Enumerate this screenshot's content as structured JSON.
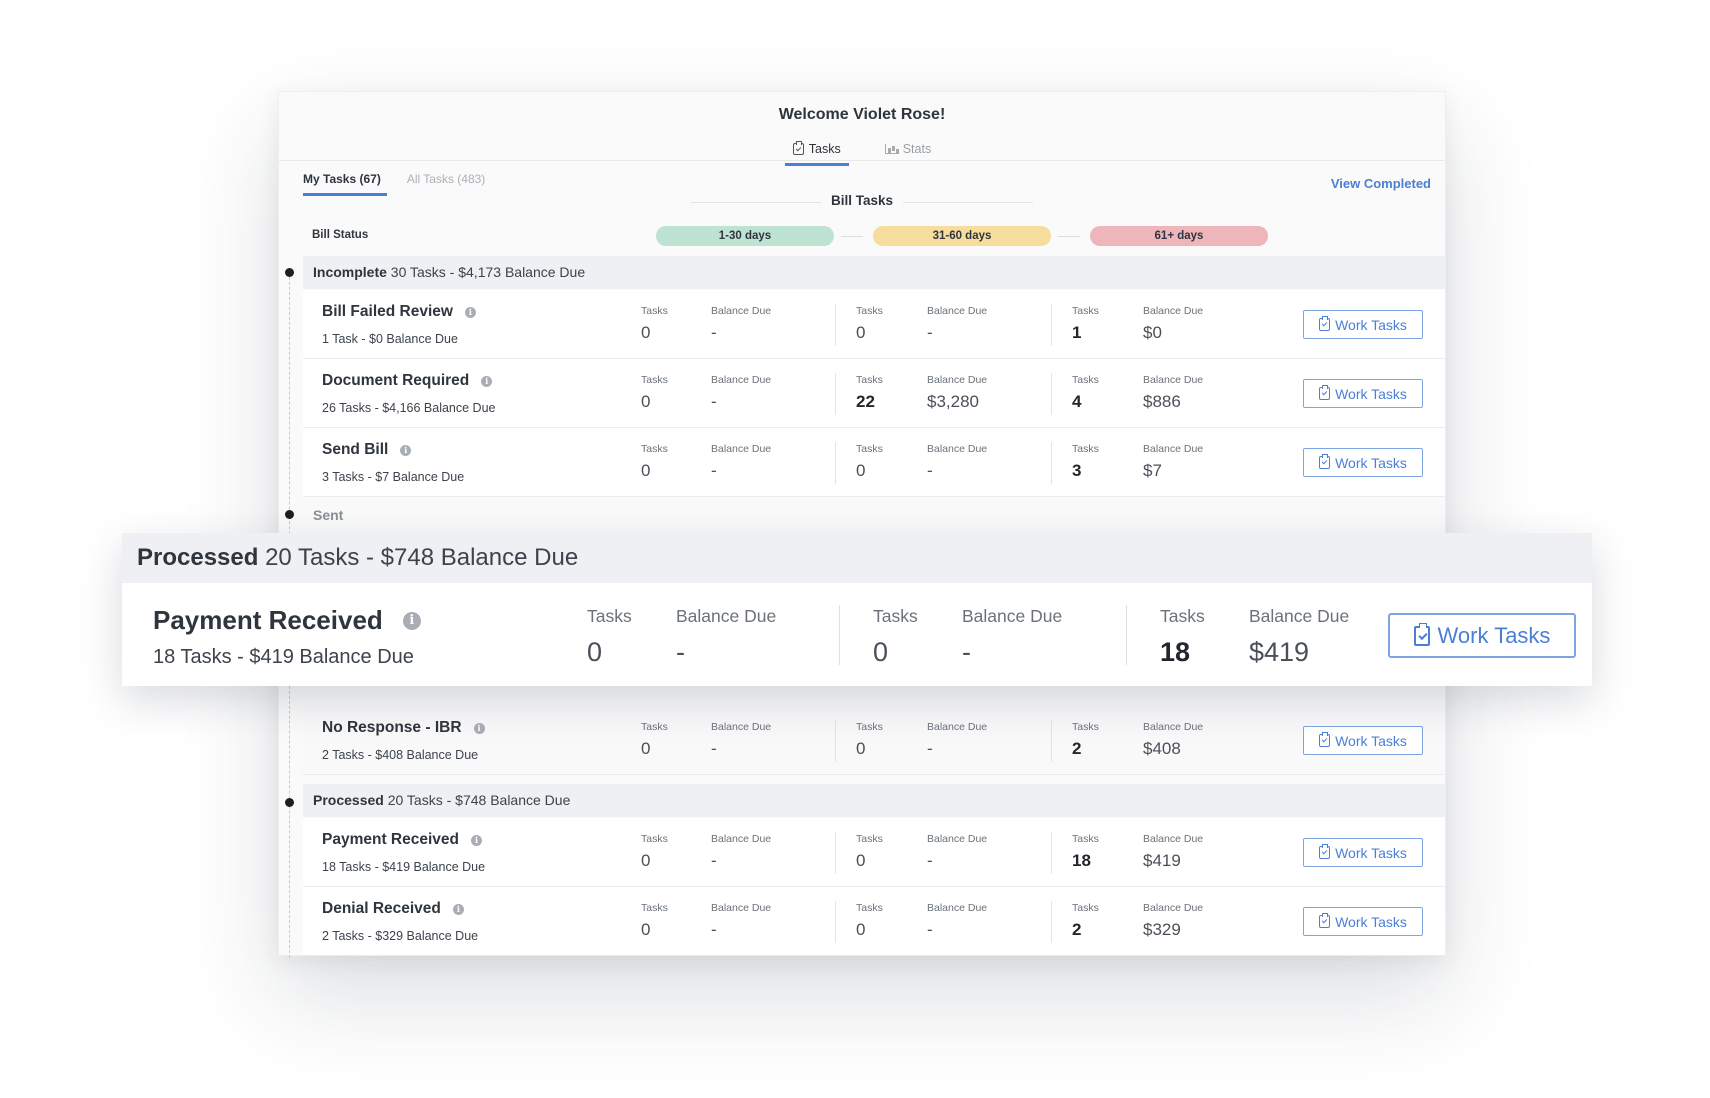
{
  "header": {
    "welcome": "Welcome Violet Rose!",
    "tabs": [
      {
        "label": "Tasks",
        "icon": "clipboard-check-icon",
        "active": true
      },
      {
        "label": "Stats",
        "icon": "bar-chart-icon",
        "active": false
      }
    ]
  },
  "subtabs": [
    {
      "label": "My Tasks (67)",
      "active": true
    },
    {
      "label": "All Tasks (483)",
      "active": false
    }
  ],
  "view_completed": "View Completed",
  "section_title": "Bill Tasks",
  "bill_status_label": "Bill Status",
  "ranges": [
    "1-30 days",
    "31-60 days",
    "61+ days"
  ],
  "range_colors": [
    "#bee3d2",
    "#f7dd9d",
    "#eeb5bb"
  ],
  "accent_color": "#4a7fd6",
  "labels": {
    "tasks": "Tasks",
    "balance": "Balance Due",
    "work_tasks": "Work Tasks"
  },
  "groups": {
    "incomplete": {
      "name": "Incomplete",
      "summary": " 30 Tasks - $4,173 Balance Due"
    },
    "sent": {
      "name": "Sent"
    },
    "processed": {
      "name": "Processed",
      "summary": " 20 Tasks - $748 Balance Due"
    }
  },
  "rows": [
    {
      "name": "Bill Failed Review",
      "summary": "1 Task - $0 Balance Due",
      "b1": {
        "tasks": "0",
        "balance": "-"
      },
      "b2": {
        "tasks": "0",
        "balance": "-"
      },
      "b3": {
        "tasks": "1",
        "balance": "$0"
      }
    },
    {
      "name": "Document Required",
      "summary": "26 Tasks - $4,166 Balance Due",
      "b1": {
        "tasks": "0",
        "balance": "-"
      },
      "b2": {
        "tasks": "22",
        "balance": "$3,280"
      },
      "b3": {
        "tasks": "4",
        "balance": "$886"
      }
    },
    {
      "name": "Send Bill",
      "summary": "3 Tasks - $7 Balance Due",
      "b1": {
        "tasks": "0",
        "balance": "-"
      },
      "b2": {
        "tasks": "0",
        "balance": "-"
      },
      "b3": {
        "tasks": "3",
        "balance": "$7"
      }
    },
    {
      "name": "No Response - IBR",
      "summary": "2 Tasks - $408 Balance Due",
      "b1": {
        "tasks": "0",
        "balance": "-"
      },
      "b2": {
        "tasks": "0",
        "balance": "-"
      },
      "b3": {
        "tasks": "2",
        "balance": "$408"
      }
    },
    {
      "name": "Payment Received",
      "summary": "18 Tasks - $419 Balance Due",
      "b1": {
        "tasks": "0",
        "balance": "-"
      },
      "b2": {
        "tasks": "0",
        "balance": "-"
      },
      "b3": {
        "tasks": "18",
        "balance": "$419"
      }
    },
    {
      "name": "Denial Received",
      "summary": "2 Tasks - $329 Balance Due",
      "b1": {
        "tasks": "0",
        "balance": "-"
      },
      "b2": {
        "tasks": "0",
        "balance": "-"
      },
      "b3": {
        "tasks": "2",
        "balance": "$329"
      }
    }
  ],
  "zoom": {
    "group_name": "Processed",
    "group_summary": " 20 Tasks - $748 Balance Due",
    "row": {
      "name": "Payment Received",
      "summary": "18 Tasks - $419 Balance Due",
      "b1": {
        "tasks": "0",
        "balance": "-"
      },
      "b2": {
        "tasks": "0",
        "balance": "-"
      },
      "b3": {
        "tasks": "18",
        "balance": "$419"
      }
    }
  }
}
